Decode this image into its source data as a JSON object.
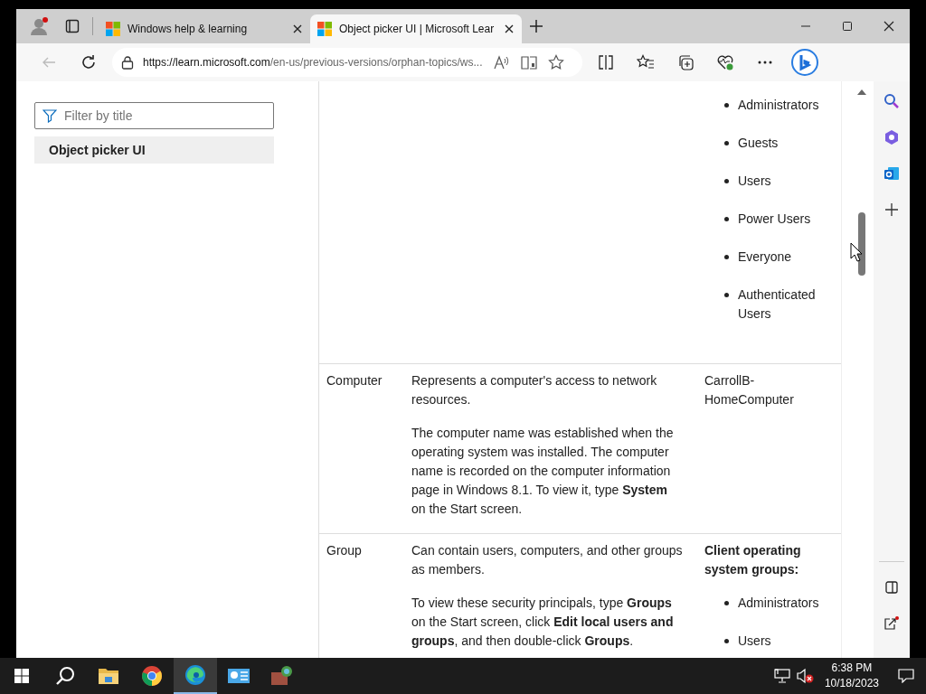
{
  "browser": {
    "tabs": [
      {
        "title": "Windows help & learning",
        "selected": false
      },
      {
        "title": "Object picker UI | Microsoft Lear",
        "selected": true
      }
    ],
    "address": {
      "host": "https://learn.microsoft.com",
      "path": "/en-us/previous-versions/orphan-topics/ws..."
    }
  },
  "sidebar": {
    "filter_placeholder": "Filter by title",
    "items": [
      {
        "label": "Object picker UI",
        "selected": true
      }
    ]
  },
  "table": {
    "rows": [
      {
        "paragraphs": [],
        "examples": {
          "items": [
            "Administrators",
            "Guests",
            "Users",
            "Power Users",
            "Everyone",
            "Authenticated Users"
          ]
        }
      },
      {
        "type": "Computer",
        "paragraphs": [
          "Represents a computer's access to network resources.",
          "The computer name was established when the operating system was installed. The computer name is recorded on the computer information page in Windows 8.1. To view it, type **System** on the Start screen."
        ],
        "examples": {
          "text": "CarrollB-HomeComputer"
        }
      },
      {
        "type": "Group",
        "paragraphs": [
          "Can contain users, computers, and other groups as members.",
          "To view these security principals, type **Groups** on the Start screen, click **Edit local users and groups**, and then double-click **Groups**."
        ],
        "examples": {
          "heading": "Client operating system groups:",
          "items": [
            "Administrators",
            "Users"
          ]
        }
      }
    ]
  },
  "taskbar": {
    "apps": [
      {
        "kind": "explorer",
        "active": false
      },
      {
        "kind": "chrome",
        "active": false
      },
      {
        "kind": "edge",
        "active": true
      },
      {
        "kind": "control",
        "active": false
      },
      {
        "kind": "network",
        "active": false
      }
    ],
    "muted": true,
    "time": "6:38 PM",
    "date": "10/18/2023"
  }
}
